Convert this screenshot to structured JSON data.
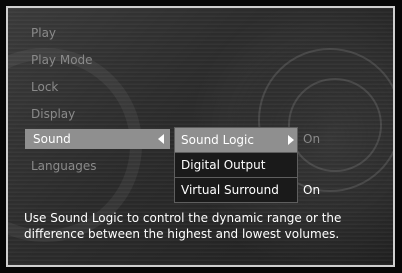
{
  "menu": {
    "items": [
      {
        "label": "Play"
      },
      {
        "label": "Play Mode"
      },
      {
        "label": "Lock"
      },
      {
        "label": "Display"
      },
      {
        "label": "Sound"
      },
      {
        "label": "Languages"
      }
    ]
  },
  "submenu": {
    "items": [
      {
        "label": "Sound Logic",
        "value": "On"
      },
      {
        "label": "Digital Output",
        "value": ""
      },
      {
        "label": "Virtual Surround",
        "value": "On"
      }
    ]
  },
  "description": "Use Sound Logic to control the dynamic range or the difference between the highest and lowest volumes.",
  "colors": {
    "background": "#2b2b2b",
    "highlight": "#8f8f8f",
    "inactive_text": "#8a8a8a",
    "active_text": "#ffffff"
  }
}
